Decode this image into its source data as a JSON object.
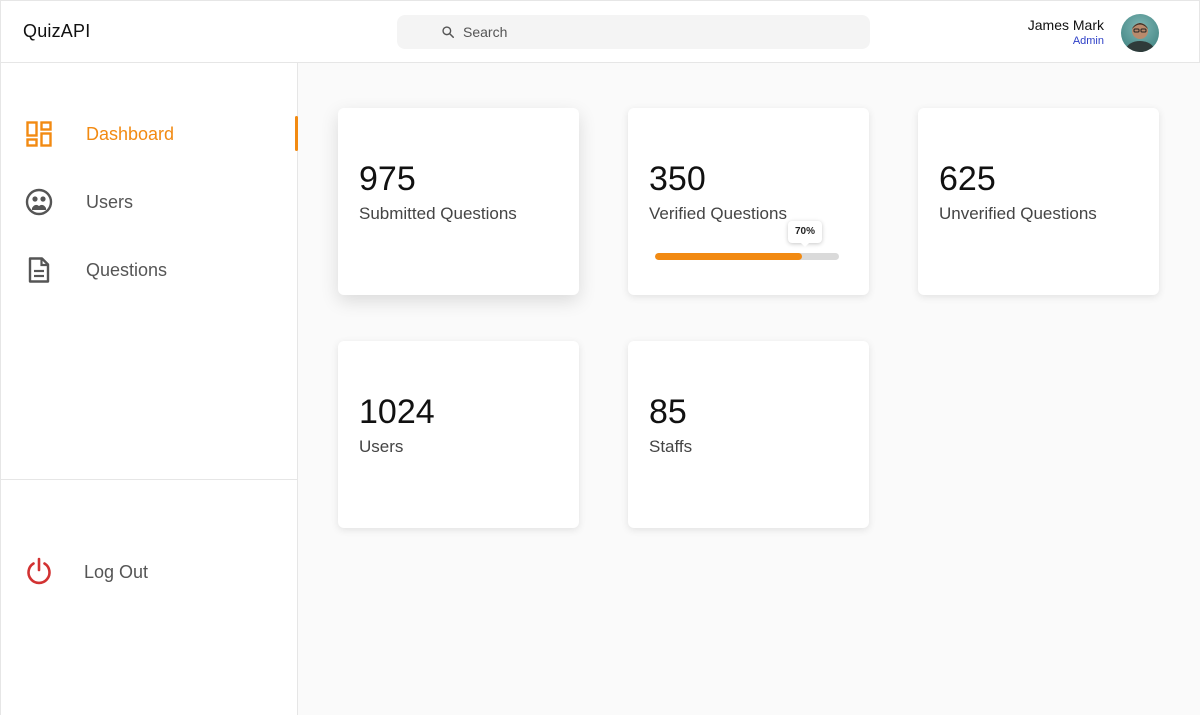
{
  "header": {
    "brand": "QuizAPI",
    "search": {
      "placeholder": "Search",
      "icon": "search-icon"
    },
    "user": {
      "name": "James Mark",
      "role": "Admin",
      "avatar": "user-avatar"
    }
  },
  "sidebar": {
    "items": [
      {
        "label": "Dashboard",
        "icon": "dashboard-icon",
        "active": true
      },
      {
        "label": "Users",
        "icon": "users-icon",
        "active": false
      },
      {
        "label": "Questions",
        "icon": "document-icon",
        "active": false
      }
    ],
    "logout": {
      "label": "Log Out",
      "icon": "power-icon"
    }
  },
  "cards": [
    {
      "value": "975",
      "label": "Submitted Questions"
    },
    {
      "value": "350",
      "label": "Verified Questions",
      "progress_percent": 80,
      "tooltip": "70%"
    },
    {
      "value": "625",
      "label": "Unverified Questions"
    },
    {
      "value": "1024",
      "label": "Users"
    },
    {
      "value": "85",
      "label": "Staffs"
    }
  ],
  "colors": {
    "accent": "#f28a12",
    "role": "#2d3fc7",
    "logout": "#d23232"
  }
}
